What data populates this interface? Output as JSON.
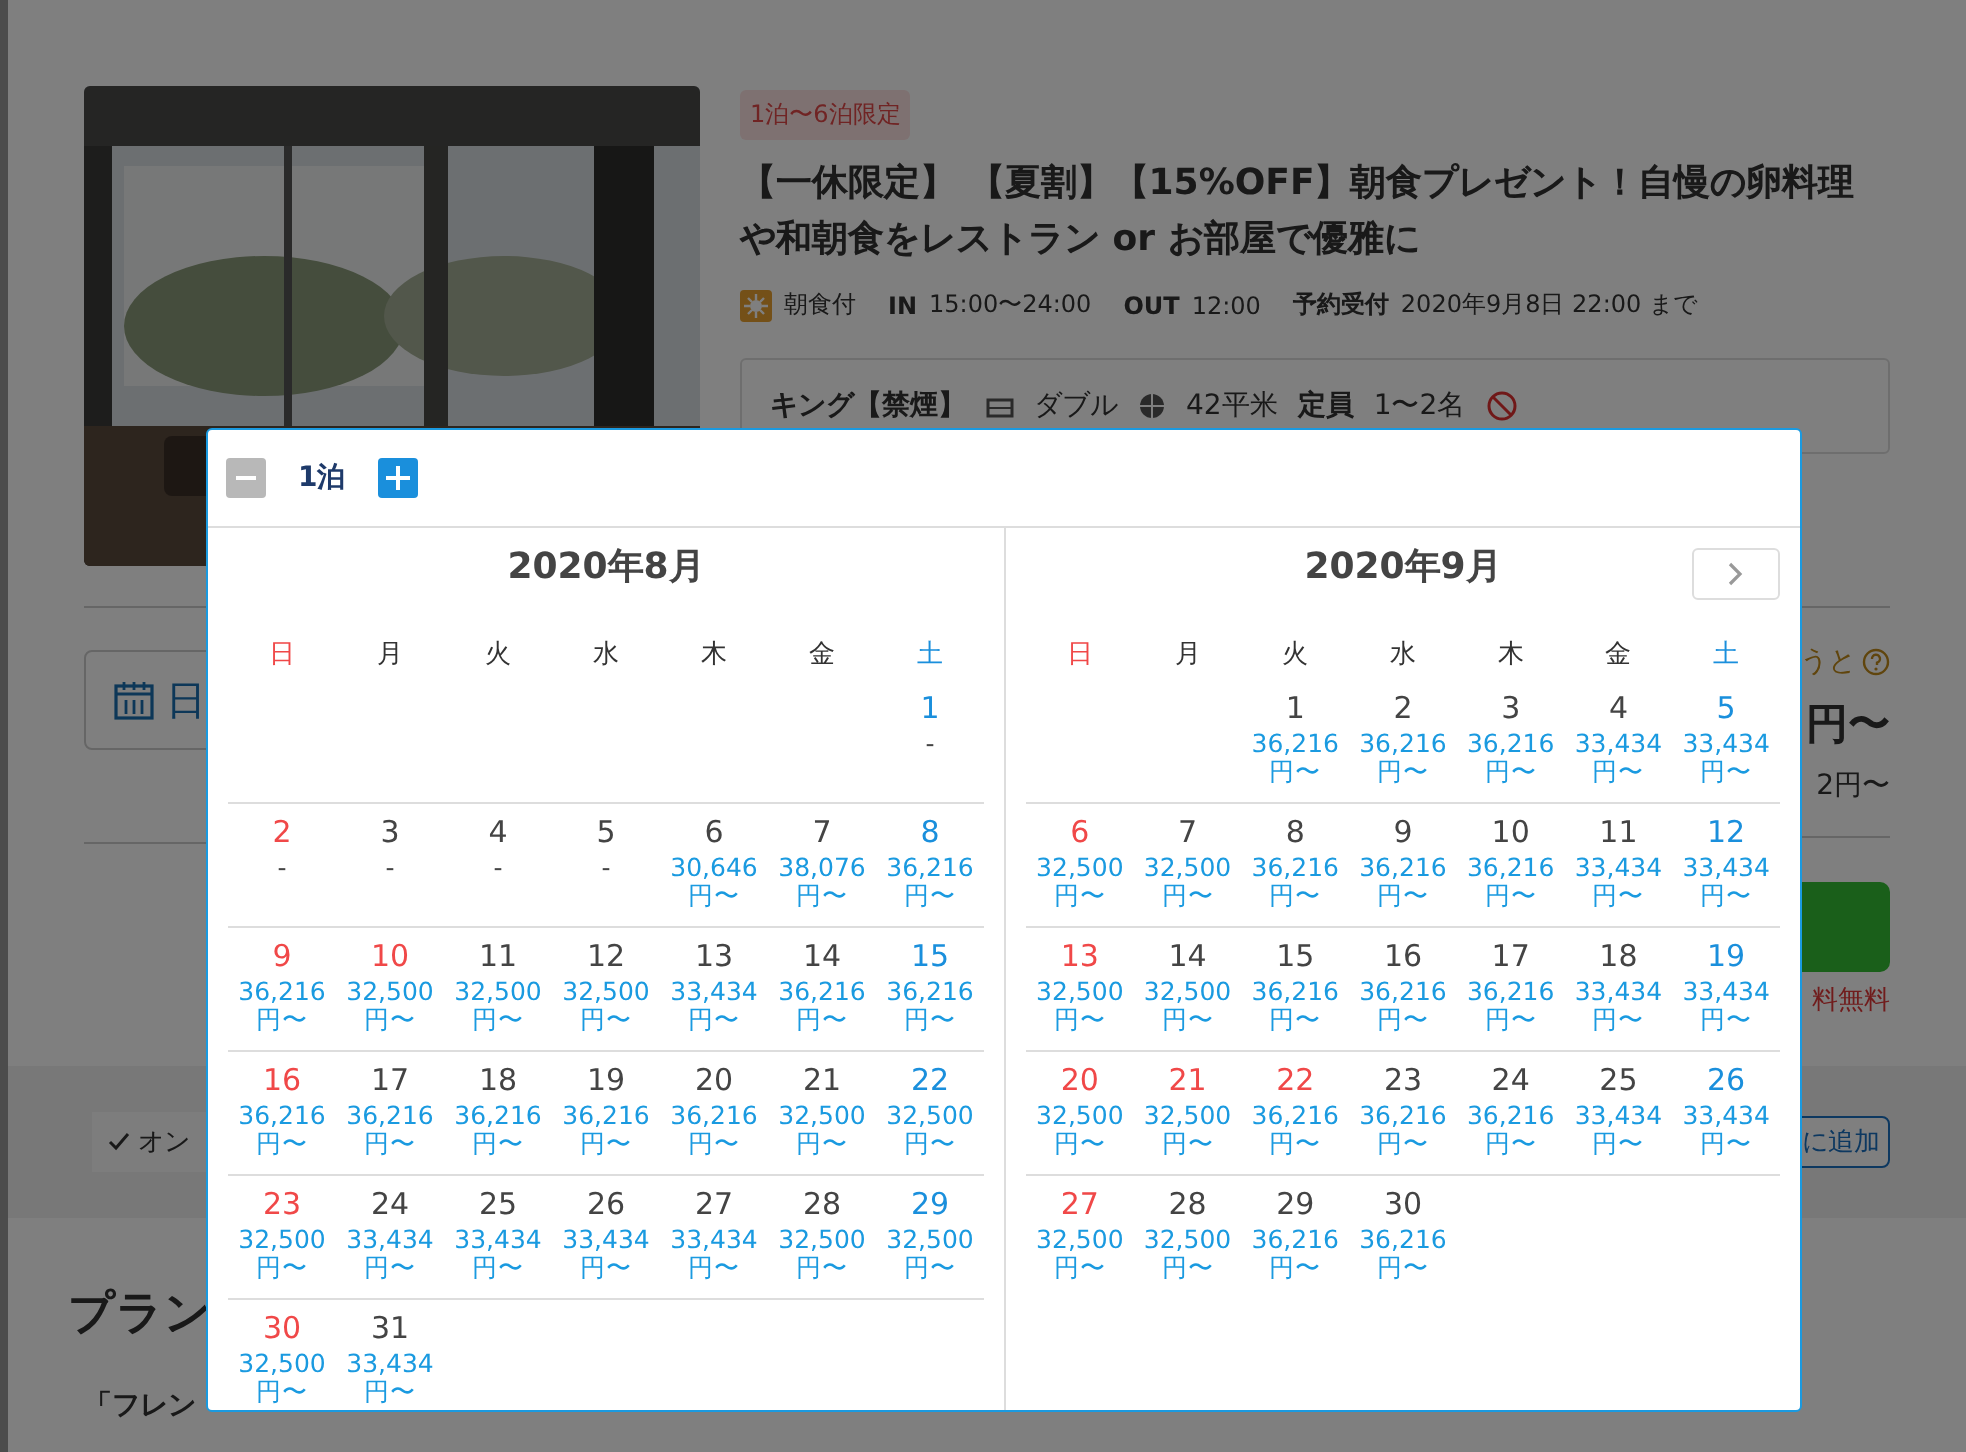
{
  "page": {
    "tag": "1泊〜6泊限定",
    "title": "【一休限定】 【夏割】【15%OFF】朝食プレゼント！自慢の卵料理や和朝食をレストラン or お部屋で優雅に",
    "meal": "朝食付",
    "checkin_label": "IN",
    "checkin": "15:00〜24:00",
    "checkout_label": "OUT",
    "checkout": "12:00",
    "deadline_label": "予約受付",
    "deadline": "2020年9月8日 22:00 まで",
    "room": {
      "name": "キング【禁煙】",
      "bed": "ダブル",
      "size": "42平米",
      "capacity_label": "定員",
      "capacity": "1〜2名"
    },
    "date_button": "日",
    "points_note": "うと",
    "price": "円〜",
    "price_sub": "2円〜",
    "cancel_note": "料無料",
    "option_chip": "オン",
    "favorite_button": "に追加",
    "section_heading": "プラン",
    "description": "「フレン"
  },
  "calendar": {
    "nights": "1泊",
    "months": [
      {
        "title": "2020年8月",
        "has_next": false,
        "weekdays": [
          "日",
          "月",
          "火",
          "水",
          "木",
          "金",
          "土"
        ],
        "weeks": [
          {
            "kind": "lead",
            "days": [
              {
                "day": "1",
                "price": "-",
                "holiday": false
              }
            ]
          },
          {
            "kind": "normal",
            "days": [
              {
                "day": "2",
                "price": "-"
              },
              {
                "day": "3",
                "price": "-",
                "holiday": false
              },
              {
                "day": "4",
                "price": "-",
                "holiday": false
              },
              {
                "day": "5",
                "price": "-",
                "holiday": false
              },
              {
                "day": "6",
                "price": "30,646",
                "unit": "円〜",
                "holiday": false
              },
              {
                "day": "7",
                "price": "38,076",
                "unit": "円〜",
                "holiday": false
              },
              {
                "day": "8",
                "price": "36,216",
                "unit": "円〜",
                "holiday": false
              }
            ]
          },
          {
            "kind": "normal",
            "days": [
              {
                "day": "9",
                "price": "36,216",
                "unit": "円〜"
              },
              {
                "day": "10",
                "price": "32,500",
                "unit": "円〜",
                "holiday": true
              },
              {
                "day": "11",
                "price": "32,500",
                "unit": "円〜",
                "holiday": false
              },
              {
                "day": "12",
                "price": "32,500",
                "unit": "円〜",
                "holiday": false
              },
              {
                "day": "13",
                "price": "33,434",
                "unit": "円〜",
                "holiday": false
              },
              {
                "day": "14",
                "price": "36,216",
                "unit": "円〜",
                "holiday": false
              },
              {
                "day": "15",
                "price": "36,216",
                "unit": "円〜",
                "holiday": false
              }
            ]
          },
          {
            "kind": "normal",
            "days": [
              {
                "day": "16",
                "price": "36,216",
                "unit": "円〜"
              },
              {
                "day": "17",
                "price": "36,216",
                "unit": "円〜",
                "holiday": false
              },
              {
                "day": "18",
                "price": "36,216",
                "unit": "円〜",
                "holiday": false
              },
              {
                "day": "19",
                "price": "36,216",
                "unit": "円〜",
                "holiday": false
              },
              {
                "day": "20",
                "price": "36,216",
                "unit": "円〜",
                "holiday": false
              },
              {
                "day": "21",
                "price": "32,500",
                "unit": "円〜",
                "holiday": false
              },
              {
                "day": "22",
                "price": "32,500",
                "unit": "円〜",
                "holiday": false
              }
            ]
          },
          {
            "kind": "normal",
            "days": [
              {
                "day": "23",
                "price": "32,500",
                "unit": "円〜"
              },
              {
                "day": "24",
                "price": "33,434",
                "unit": "円〜",
                "holiday": false
              },
              {
                "day": "25",
                "price": "33,434",
                "unit": "円〜",
                "holiday": false
              },
              {
                "day": "26",
                "price": "33,434",
                "unit": "円〜",
                "holiday": false
              },
              {
                "day": "27",
                "price": "33,434",
                "unit": "円〜",
                "holiday": false
              },
              {
                "day": "28",
                "price": "32,500",
                "unit": "円〜",
                "holiday": false
              },
              {
                "day": "29",
                "price": "32,500",
                "unit": "円〜",
                "holiday": false
              }
            ]
          },
          {
            "kind": "normal",
            "days": [
              {
                "day": "30",
                "price": "32,500",
                "unit": "円〜"
              },
              {
                "day": "31",
                "price": "33,434",
                "unit": "円〜",
                "holiday": false
              }
            ]
          }
        ]
      },
      {
        "title": "2020年9月",
        "has_next": true,
        "weekdays": [
          "日",
          "月",
          "火",
          "水",
          "木",
          "金",
          "土"
        ],
        "weeks": [
          {
            "kind": "lead",
            "days": [
              {
                "day": "1",
                "price": "36,216",
                "unit": "円〜",
                "holiday": false
              },
              {
                "day": "2",
                "price": "36,216",
                "unit": "円〜",
                "holiday": false
              },
              {
                "day": "3",
                "price": "36,216",
                "unit": "円〜",
                "holiday": false
              },
              {
                "day": "4",
                "price": "33,434",
                "unit": "円〜",
                "holiday": false
              },
              {
                "day": "5",
                "price": "33,434",
                "unit": "円〜",
                "holiday": false
              }
            ]
          },
          {
            "kind": "normal",
            "days": [
              {
                "day": "6",
                "price": "32,500",
                "unit": "円〜"
              },
              {
                "day": "7",
                "price": "32,500",
                "unit": "円〜",
                "holiday": false
              },
              {
                "day": "8",
                "price": "36,216",
                "unit": "円〜",
                "holiday": false
              },
              {
                "day": "9",
                "price": "36,216",
                "unit": "円〜",
                "holiday": false
              },
              {
                "day": "10",
                "price": "36,216",
                "unit": "円〜",
                "holiday": false
              },
              {
                "day": "11",
                "price": "33,434",
                "unit": "円〜",
                "holiday": false
              },
              {
                "day": "12",
                "price": "33,434",
                "unit": "円〜",
                "holiday": false
              }
            ]
          },
          {
            "kind": "normal",
            "days": [
              {
                "day": "13",
                "price": "32,500",
                "unit": "円〜"
              },
              {
                "day": "14",
                "price": "32,500",
                "unit": "円〜",
                "holiday": false
              },
              {
                "day": "15",
                "price": "36,216",
                "unit": "円〜",
                "holiday": false
              },
              {
                "day": "16",
                "price": "36,216",
                "unit": "円〜",
                "holiday": false
              },
              {
                "day": "17",
                "price": "36,216",
                "unit": "円〜",
                "holiday": false
              },
              {
                "day": "18",
                "price": "33,434",
                "unit": "円〜",
                "holiday": false
              },
              {
                "day": "19",
                "price": "33,434",
                "unit": "円〜",
                "holiday": false
              }
            ]
          },
          {
            "kind": "normal",
            "days": [
              {
                "day": "20",
                "price": "32,500",
                "unit": "円〜"
              },
              {
                "day": "21",
                "price": "32,500",
                "unit": "円〜",
                "holiday": true
              },
              {
                "day": "22",
                "price": "36,216",
                "unit": "円〜",
                "holiday": true
              },
              {
                "day": "23",
                "price": "36,216",
                "unit": "円〜",
                "holiday": false
              },
              {
                "day": "24",
                "price": "36,216",
                "unit": "円〜",
                "holiday": false
              },
              {
                "day": "25",
                "price": "33,434",
                "unit": "円〜",
                "holiday": false
              },
              {
                "day": "26",
                "price": "33,434",
                "unit": "円〜",
                "holiday": false
              }
            ]
          },
          {
            "kind": "normal",
            "days": [
              {
                "day": "27",
                "price": "32,500",
                "unit": "円〜"
              },
              {
                "day": "28",
                "price": "32,500",
                "unit": "円〜",
                "holiday": false
              },
              {
                "day": "29",
                "price": "36,216",
                "unit": "円〜",
                "holiday": false
              },
              {
                "day": "30",
                "price": "36,216",
                "unit": "円〜",
                "holiday": false
              }
            ]
          }
        ]
      }
    ]
  }
}
